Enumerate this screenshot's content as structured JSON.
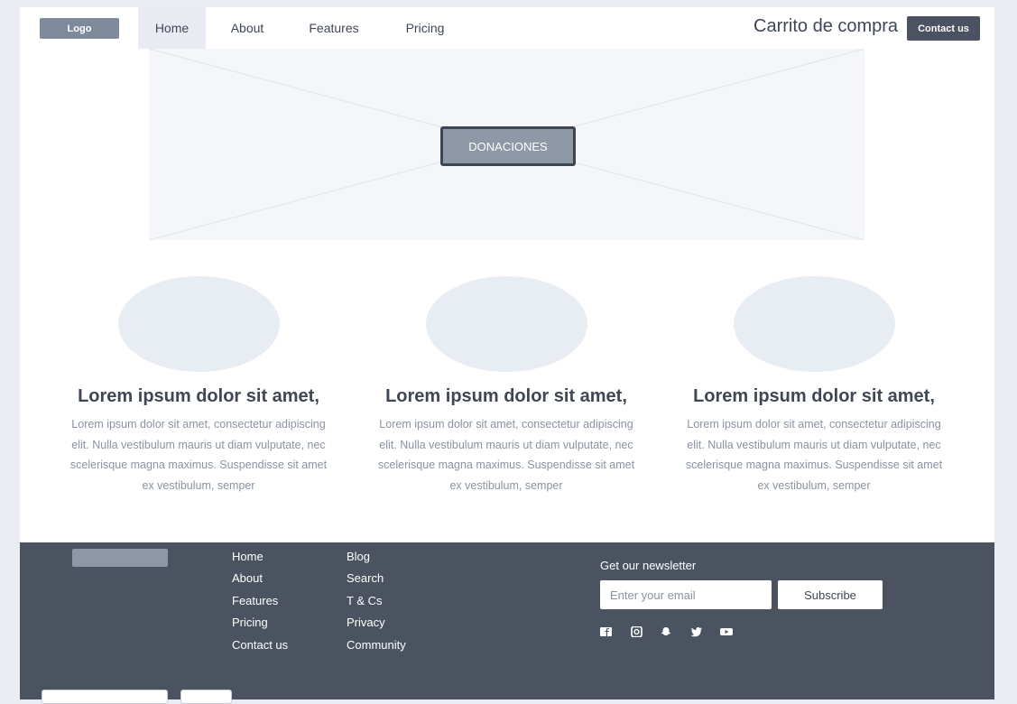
{
  "header": {
    "logo": "Logo",
    "nav": [
      {
        "label": "Home",
        "active": true
      },
      {
        "label": "About",
        "active": false
      },
      {
        "label": "Features",
        "active": false
      },
      {
        "label": "Pricing",
        "active": false
      }
    ],
    "cart": "Carrito de compra",
    "contact": "Contact us"
  },
  "hero": {
    "button": "DONACIONES"
  },
  "features": [
    {
      "title": "Lorem ipsum dolor sit amet,",
      "text": "Lorem ipsum dolor sit amet, consectetur adipiscing elit. Nulla vestibulum mauris ut diam vulputate, nec scelerisque magna maximus. Suspendisse sit amet ex vestibulum, semper"
    },
    {
      "title": "Lorem ipsum dolor sit amet,",
      "text": "Lorem ipsum dolor sit amet, consectetur adipiscing elit. Nulla vestibulum mauris ut diam vulputate, nec scelerisque magna maximus. Suspendisse sit amet ex vestibulum, semper"
    },
    {
      "title": "Lorem ipsum dolor sit amet,",
      "text": "Lorem ipsum dolor sit amet, consectetur adipiscing elit. Nulla vestibulum mauris ut diam vulputate, nec scelerisque magna maximus. Suspendisse sit amet ex vestibulum, semper"
    }
  ],
  "footer": {
    "col1": [
      "Home",
      "About",
      "Features",
      "Pricing",
      "Contact us"
    ],
    "col2": [
      "Blog",
      "Search",
      "T & Cs",
      "Privacy",
      "Community"
    ],
    "newsletter": {
      "title": "Get our newsletter",
      "placeholder": "Enter your email",
      "button": "Subscribe"
    },
    "social": [
      "facebook-icon",
      "instagram-icon",
      "snapchat-icon",
      "twitter-icon",
      "youtube-icon"
    ]
  },
  "colors": {
    "accent": "#4b5261",
    "footer_bg": "#4b5360",
    "placeholder": "#e8ecf3"
  }
}
